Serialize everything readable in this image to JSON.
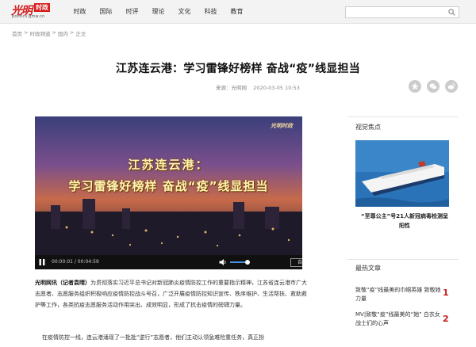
{
  "header": {
    "logo": {
      "main": "光明",
      "tag": "时政",
      "url": "politics.gmw.cn"
    },
    "nav": [
      "时政",
      "国际",
      "时评",
      "理论",
      "文化",
      "科技",
      "教育"
    ],
    "search": {
      "placeholder": ""
    }
  },
  "breadcrumb": [
    "首页",
    ">",
    "时政频道",
    ">",
    "国内",
    ">",
    "正文"
  ],
  "article": {
    "title": "江苏连云港：学习雷锋好榜样 奋战“疫”线显担当",
    "source_label": "来源：光明网",
    "date": "2020-03-05 10:53",
    "lead": "光明网讯（记者袁晴）",
    "para1": "为贯彻落实习近平总书记对新冠肺炎疫情防控工作的重要指示精神，江苏省连云港市广大志愿者、志愿服务组织积极响应疫情防控战斗号召，广泛开展疫情防控知识宣传、秩序维护、生活帮扶、救助救护等工作，各类抗疫志愿服务活动作用突出、成效明显，形成了抗击疫情的磅礴力量。",
    "para2": "在疫情防控一线，连云港涌现了一批批“逆行”志愿者，他们主动认领急难险重任务，真正扮"
  },
  "video": {
    "logo": "光明时政",
    "title_line1": "江苏连云港：",
    "title_line2": "学习雷锋好榜样  奋战“疫”线显担当",
    "time": "00:00:01 / 00:04:59",
    "auto_label": "自动",
    "volume": 0.8
  },
  "sidebar": {
    "focus_title": "视觉焦点",
    "focus_caption": "“至尊公主”号21人新冠病毒检测呈阳性",
    "hot_title": "最热文章",
    "hot_items": [
      {
        "text": "致敬“疫”线最美的巾帼英雄 致敬她力量",
        "rank": "1"
      },
      {
        "text": "MV|致敬“疫”线最美的“她” 白衣女战士们的心声",
        "rank": "2"
      }
    ]
  },
  "colors": {
    "brand_red": "#d41a1a",
    "rank_red": "#c81a1a",
    "volume_blue": "#4a8fe0"
  }
}
